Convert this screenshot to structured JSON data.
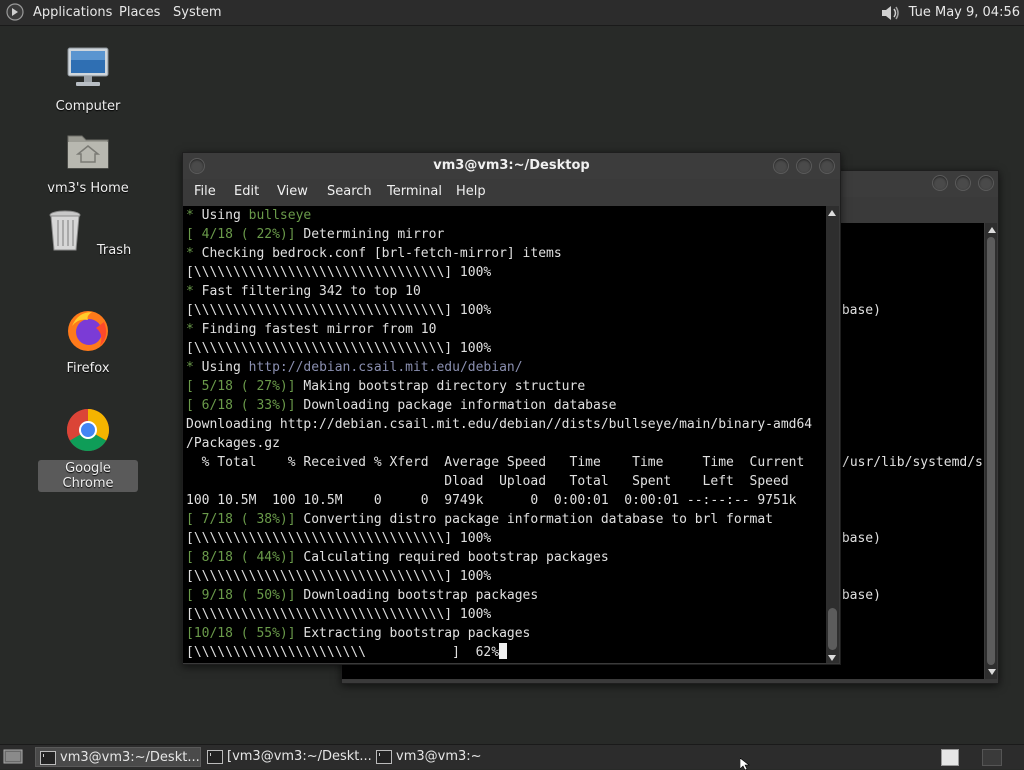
{
  "top_panel": {
    "menus": [
      "Applications",
      "Places",
      "System"
    ],
    "clock": "Tue May 9, 04:56"
  },
  "desktop_icons": [
    {
      "label": "Computer",
      "icon": "computer-icon"
    },
    {
      "label": "vm3's Home",
      "icon": "home-folder-icon"
    },
    {
      "label": "Trash",
      "icon": "trash-icon"
    },
    {
      "label": "Firefox",
      "icon": "firefox-icon"
    },
    {
      "label": "Google Chrome",
      "icon": "chrome-icon",
      "selected": true
    }
  ],
  "terminal": {
    "title": "vm3@vm3:~/Desktop",
    "menu": [
      "File",
      "Edit",
      "View",
      "Search",
      "Terminal",
      "Help"
    ],
    "lines": [
      [
        {
          "t": "* ",
          "c": "g"
        },
        {
          "t": "Using "
        },
        {
          "t": "bullseye",
          "c": "g"
        }
      ],
      [
        {
          "t": "[ 4/18 ( 22%)]",
          "c": "g"
        },
        {
          "t": " Determining mirror"
        }
      ],
      [
        {
          "t": "* ",
          "c": "g"
        },
        {
          "t": "Checking bedrock.conf [brl-fetch-mirror] items"
        }
      ],
      [
        {
          "t": "[\\\\\\\\\\\\\\\\\\\\\\\\\\\\\\\\\\\\\\\\\\\\\\\\\\\\\\\\\\\\\\\\] 100%"
        }
      ],
      [
        {
          "t": "* ",
          "c": "g"
        },
        {
          "t": "Fast filtering 342 to top 10"
        }
      ],
      [
        {
          "t": "[\\\\\\\\\\\\\\\\\\\\\\\\\\\\\\\\\\\\\\\\\\\\\\\\\\\\\\\\\\\\\\\\] 100%"
        }
      ],
      [
        {
          "t": "* ",
          "c": "g"
        },
        {
          "t": "Finding fastest mirror from 10"
        }
      ],
      [
        {
          "t": "[\\\\\\\\\\\\\\\\\\\\\\\\\\\\\\\\\\\\\\\\\\\\\\\\\\\\\\\\\\\\\\\\] 100%"
        }
      ],
      [
        {
          "t": "* ",
          "c": "g"
        },
        {
          "t": "Using "
        },
        {
          "t": "http://debian.csail.mit.edu/debian/",
          "c": "u"
        }
      ],
      [
        {
          "t": "[ 5/18 ( 27%)]",
          "c": "g"
        },
        {
          "t": " Making bootstrap directory structure"
        }
      ],
      [
        {
          "t": "[ 6/18 ( 33%)]",
          "c": "g"
        },
        {
          "t": " Downloading package information database"
        }
      ],
      [
        {
          "t": "Downloading http://debian.csail.mit.edu/debian//dists/bullseye/main/binary-amd64"
        }
      ],
      [
        {
          "t": "/Packages.gz"
        }
      ],
      [
        {
          "t": "  % Total    % Received % Xferd  Average Speed   Time    Time     Time  Current"
        }
      ],
      [
        {
          "t": "                                 Dload  Upload   Total   Spent    Left  Speed"
        }
      ],
      [
        {
          "t": "100 10.5M  100 10.5M    0     0  9749k      0  0:00:01  0:00:01 --:--:-- 9751k"
        }
      ],
      [
        {
          "t": "[ 7/18 ( 38%)]",
          "c": "g"
        },
        {
          "t": " Converting distro package information database to brl format"
        }
      ],
      [
        {
          "t": "[\\\\\\\\\\\\\\\\\\\\\\\\\\\\\\\\\\\\\\\\\\\\\\\\\\\\\\\\\\\\\\\\] 100%"
        }
      ],
      [
        {
          "t": "[ 8/18 ( 44%)]",
          "c": "g"
        },
        {
          "t": " Calculating required bootstrap packages"
        }
      ],
      [
        {
          "t": "[\\\\\\\\\\\\\\\\\\\\\\\\\\\\\\\\\\\\\\\\\\\\\\\\\\\\\\\\\\\\\\\\] 100%"
        }
      ],
      [
        {
          "t": "[ 9/18 ( 50%)]",
          "c": "g"
        },
        {
          "t": " Downloading bootstrap packages"
        }
      ],
      [
        {
          "t": "[\\\\\\\\\\\\\\\\\\\\\\\\\\\\\\\\\\\\\\\\\\\\\\\\\\\\\\\\\\\\\\\\] 100%"
        }
      ],
      [
        {
          "t": "[10/18 ( 55%)]",
          "c": "g"
        },
        {
          "t": " Extracting bootstrap packages"
        }
      ],
      [
        {
          "t": "[\\\\\\\\\\\\\\\\\\\\\\\\\\\\\\\\\\\\\\\\\\\\           ]  62%"
        },
        {
          "cursor": true
        }
      ]
    ]
  },
  "background_terminal": {
    "visible_fragments": [
      "abase)",
      "/usr/lib/systemd/s",
      "abase)",
      "abase)"
    ]
  },
  "taskbar": {
    "items": [
      "vm3@vm3:~/Deskt...",
      "[vm3@vm3:~/Deskt...",
      "vm3@vm3:~"
    ],
    "active_index": 0
  },
  "colors": {
    "panel": "#2c2c2c",
    "desktop": "#282a28",
    "terminal_bg": "#000000",
    "terminal_fg": "#e0e0e0",
    "terminal_green": "#6a9a4a",
    "terminal_url": "#8a8fb0"
  }
}
